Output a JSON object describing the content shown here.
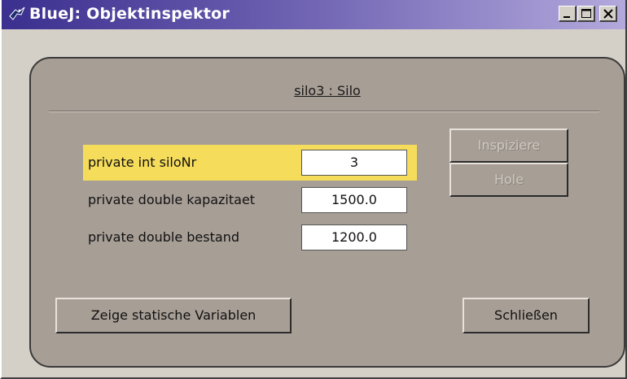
{
  "window": {
    "title": "BlueJ:  Objektinspektor"
  },
  "inspector": {
    "object_title": "silo3 : Silo",
    "fields": [
      {
        "label": "private int siloNr",
        "value": "3",
        "selected": true
      },
      {
        "label": "private double kapazitaet",
        "value": "1500.0",
        "selected": false
      },
      {
        "label": "private double bestand",
        "value": "1200.0",
        "selected": false
      }
    ],
    "buttons": {
      "inspect": "Inspiziere",
      "get": "Hole",
      "show_static": "Zeige statische Variablen",
      "close": "Schließen"
    }
  },
  "colors": {
    "panel": "#a79e96",
    "highlight": "#f5dc5a",
    "titlebar_start": "#3b2f8f",
    "titlebar_end": "#b3a9dc"
  },
  "icons": {
    "app": "bluej-bird-icon",
    "minimize": "minimize-icon",
    "maximize": "maximize-icon",
    "close": "close-icon"
  }
}
